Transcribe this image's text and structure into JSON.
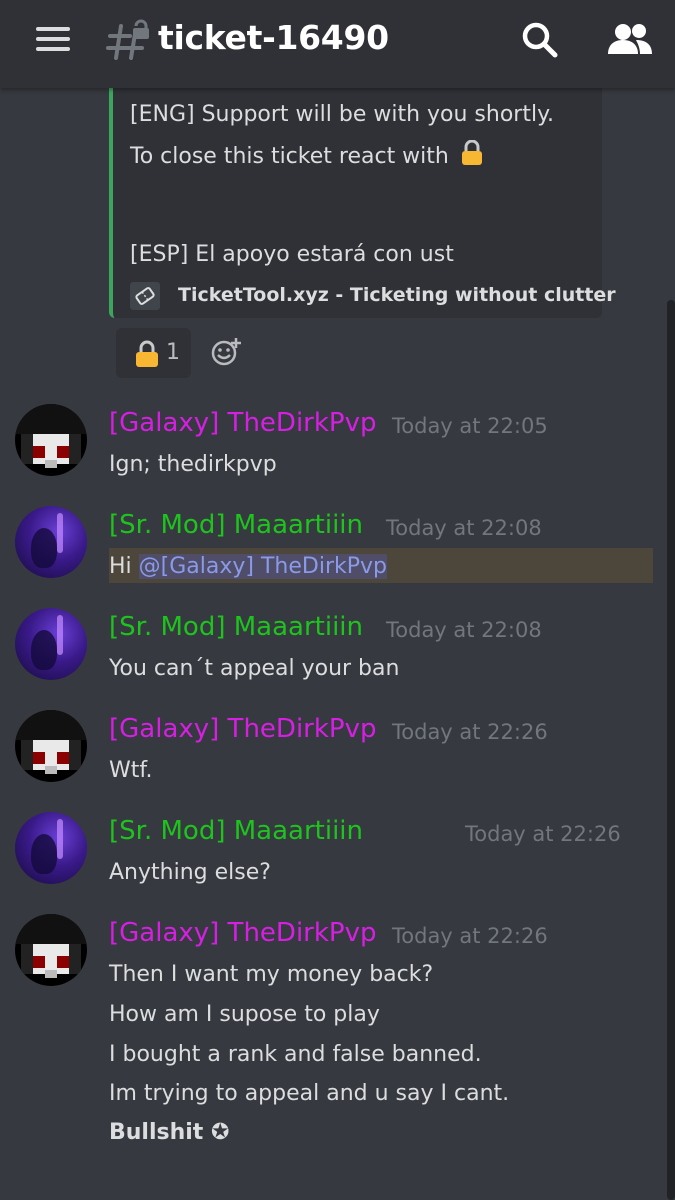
{
  "header": {
    "channel_name": "ticket-16490"
  },
  "embed": {
    "lines": [
      "[ENG] Support will be with you shortly.",
      "To close this ticket react with",
      "[ESP] El apoyo estará con ust"
    ],
    "footer_text": "TicketTool.xyz - Ticketing without clutter",
    "accent_color": "#3ba55d"
  },
  "reaction": {
    "emoji": "lock",
    "count": "1"
  },
  "messages": [
    {
      "author": "[Galaxy] TheDirkPvp",
      "time": "Today at 22:05",
      "lines": [
        "Ign; thedirkpvp"
      ]
    },
    {
      "author": "[Sr. Mod] Maaartiiin",
      "time": "Today at 22:08",
      "prefix": "Hi ",
      "mention": "@[Galaxy] TheDirkPvp"
    },
    {
      "author": "[Sr. Mod] Maaartiiin",
      "time": "Today at 22:08",
      "lines": [
        "You can´t appeal your ban"
      ]
    },
    {
      "author": "[Galaxy] TheDirkPvp",
      "time": "Today at 22:26",
      "lines": [
        "Wtf."
      ]
    },
    {
      "author": "[Sr. Mod] Maaartiiin",
      "time": "Today at 22:26",
      "lines": [
        "Anything else?"
      ]
    },
    {
      "author": "[Galaxy] TheDirkPvp",
      "time": "Today at 22:26",
      "lines": [
        "Then I want my money back?",
        "How am I supose to play",
        "I bought a rank and false banned.",
        "Im trying to appeal and u say I cant.",
        "Bullshit ✪"
      ]
    }
  ],
  "colors": {
    "galaxy_role": "#d61fe3",
    "mod_role": "#1ec31e",
    "background": "#36393f",
    "header": "#2f3136"
  }
}
